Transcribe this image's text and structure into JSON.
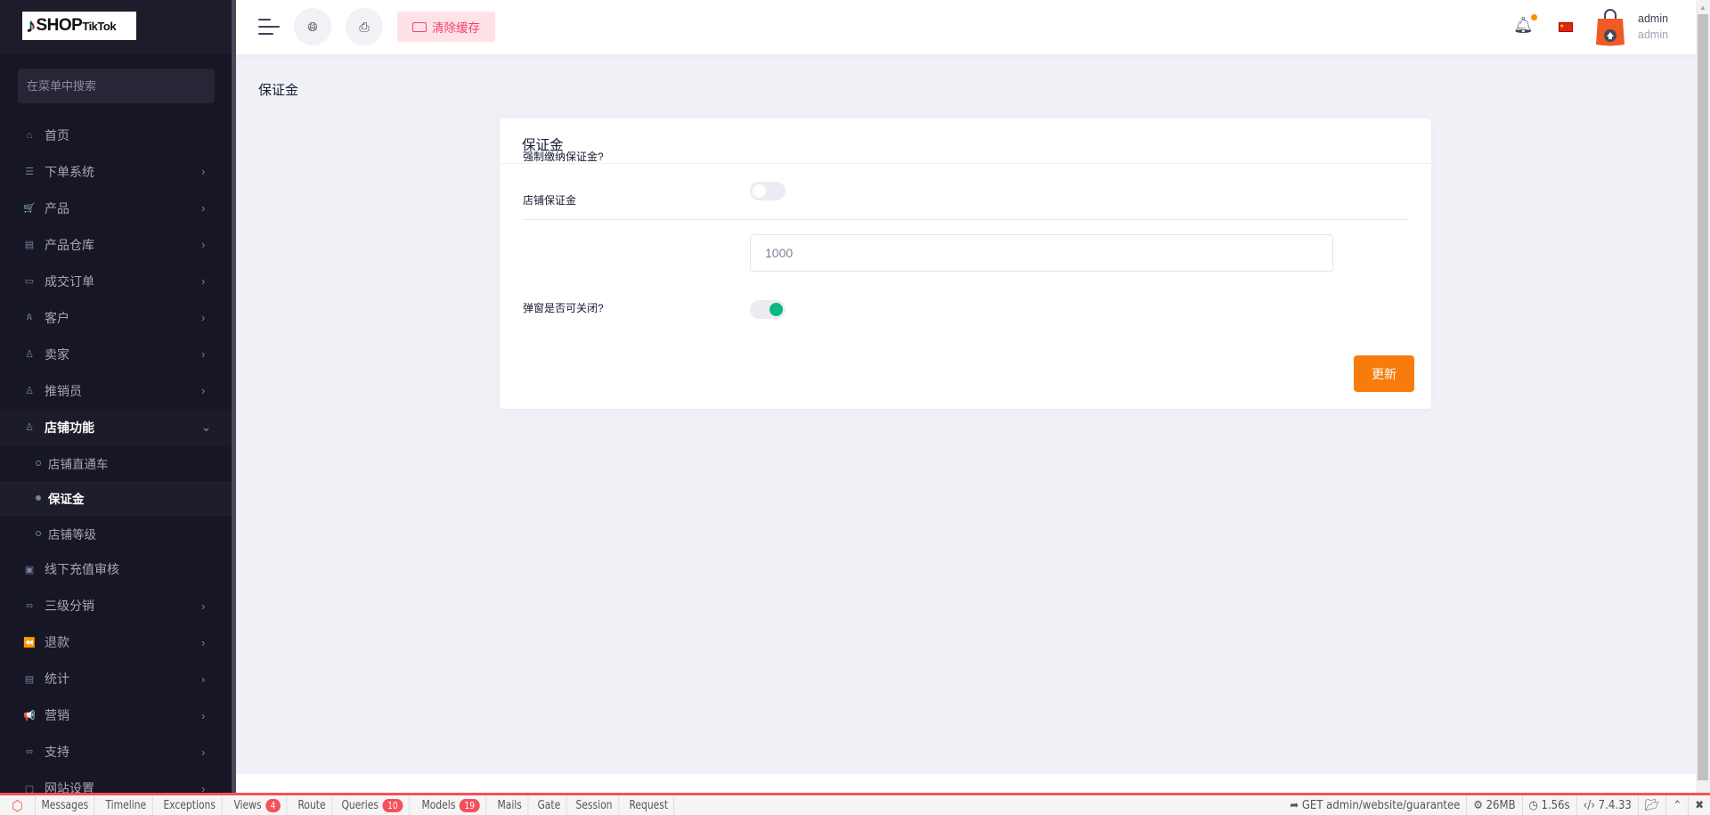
{
  "brand": {
    "logo_text": "SHOP",
    "logo_sub": "TikTok"
  },
  "sidebar": {
    "search_placeholder": "在菜单中搜索",
    "items": [
      {
        "label": "首页",
        "icon": "home-icon",
        "glyph": "⌂"
      },
      {
        "label": "下单系统",
        "icon": "list-icon",
        "glyph": "☰"
      },
      {
        "label": "产品",
        "icon": "cart-icon",
        "glyph": "🛒"
      },
      {
        "label": "产品仓库",
        "icon": "warehouse-icon",
        "glyph": "▤"
      },
      {
        "label": "成交订单",
        "icon": "money-icon",
        "glyph": "▭"
      },
      {
        "label": "客户",
        "icon": "users-icon",
        "glyph": "ጰ"
      },
      {
        "label": "卖家",
        "icon": "user-icon",
        "glyph": "♙"
      },
      {
        "label": "推销员",
        "icon": "user-icon",
        "glyph": "♙"
      },
      {
        "label": "店铺功能",
        "icon": "user-icon",
        "glyph": "♙"
      }
    ],
    "subitems": [
      {
        "label": "店铺直通车"
      },
      {
        "label": "保证金"
      },
      {
        "label": "店铺等级"
      }
    ],
    "items2": [
      {
        "label": "线下充值审核",
        "icon": "cash-icon",
        "glyph": "▣"
      },
      {
        "label": "三级分销",
        "icon": "link-icon",
        "glyph": "∞"
      },
      {
        "label": "退款",
        "icon": "rewind-icon",
        "glyph": "⏪"
      },
      {
        "label": "统计",
        "icon": "document-icon",
        "glyph": "▤"
      },
      {
        "label": "营销",
        "icon": "megaphone-icon",
        "glyph": "📢"
      },
      {
        "label": "支持",
        "icon": "link-icon",
        "glyph": "∞"
      },
      {
        "label": "网站设置",
        "icon": "window-icon",
        "glyph": "▢"
      }
    ]
  },
  "header": {
    "clear_cache": "清除缓存",
    "user_name": "admin",
    "user_role": "admin"
  },
  "page": {
    "title": "保证金"
  },
  "card": {
    "title": "保证金",
    "force_deposit_label": "强制缴纳保证金?",
    "force_deposit_on": false,
    "shop_deposit_label": "店铺保证金",
    "shop_deposit_value": "1000",
    "popup_closable_label": "弹窗是否可关闭?",
    "popup_closable_on": true,
    "update_button": "更新"
  },
  "debugbar": {
    "tabs": [
      {
        "label": "Messages"
      },
      {
        "label": "Timeline"
      },
      {
        "label": "Exceptions"
      },
      {
        "label": "Views",
        "count": "4"
      },
      {
        "label": "Route"
      },
      {
        "label": "Queries",
        "count": "10"
      },
      {
        "label": "Models",
        "count": "19"
      },
      {
        "label": "Mails"
      },
      {
        "label": "Gate"
      },
      {
        "label": "Session"
      },
      {
        "label": "Request"
      }
    ],
    "request": "GET admin/website/guarantee",
    "memory": "26MB",
    "time": "1.56s",
    "php": "7.4.33"
  }
}
